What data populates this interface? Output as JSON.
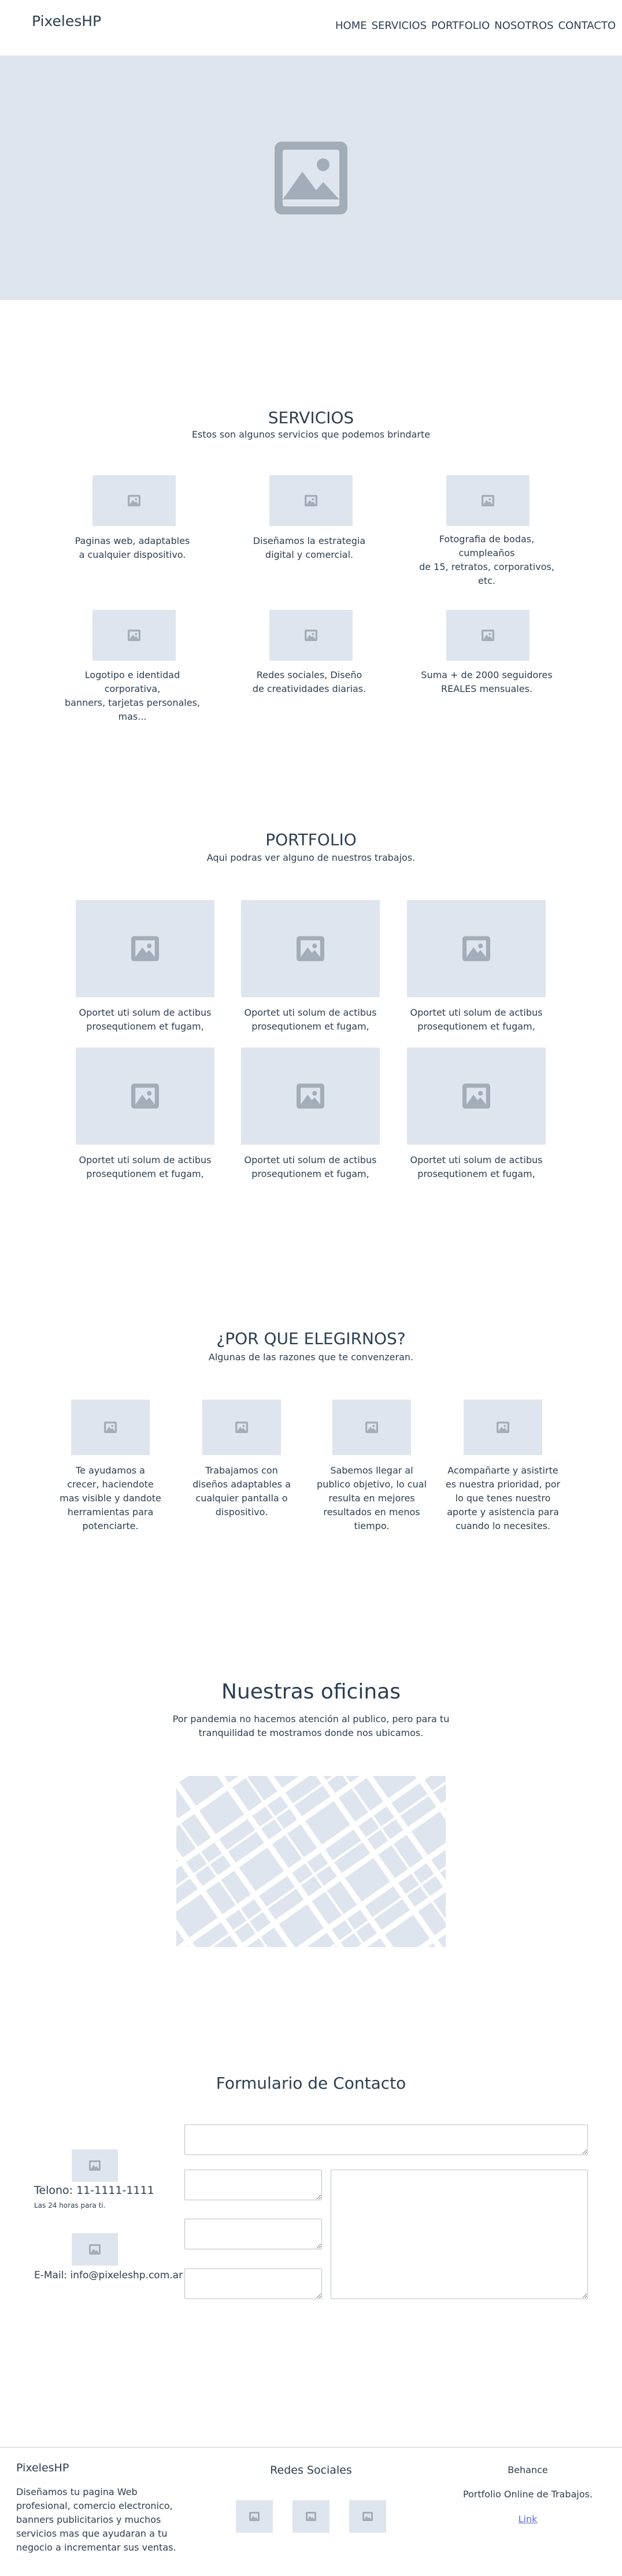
{
  "header": {
    "brand": "PixelesHP",
    "nav": [
      "HOME",
      "SERVICIOS",
      "PORTFOLIO",
      "NOSOTROS",
      "CONTACTO"
    ]
  },
  "hero": {
    "icon": "image-placeholder-icon"
  },
  "servicios": {
    "title": "SERVICIOS",
    "subtitle": "Estos son algunos servicios que podemos brindarte",
    "items": [
      {
        "lines": [
          "Paginas web, adaptables",
          "a cualquier dispositivo."
        ]
      },
      {
        "lines": [
          "Diseñamos la estrategia",
          "digital y comercial."
        ]
      },
      {
        "lines": [
          "Fotografia de bodas, cumpleaños",
          "de 15, retratos, corporativos, etc."
        ]
      },
      {
        "lines": [
          "Logotipo e identidad corporativa,",
          "banners, tarjetas personales,",
          "mas..."
        ]
      },
      {
        "lines": [
          "Redes sociales, Diseño",
          "de creatividades diarias."
        ]
      },
      {
        "lines": [
          "Suma + de 2000 seguidores",
          "REALES mensuales."
        ]
      }
    ]
  },
  "portfolio": {
    "title": "PORTFOLIO",
    "subtitle": "Aqui podras ver alguno de nuestros trabajos.",
    "items": [
      {
        "lines": [
          "Oportet uti solum de actibus",
          "prosequtionem et fugam,"
        ]
      },
      {
        "lines": [
          "Oportet uti solum de actibus",
          "prosequtionem et fugam,"
        ]
      },
      {
        "lines": [
          "Oportet uti solum de actibus",
          "prosequtionem et fugam,"
        ]
      },
      {
        "lines": [
          "Oportet uti solum de actibus",
          "prosequtionem et fugam,"
        ]
      },
      {
        "lines": [
          "Oportet uti solum de actibus",
          "prosequtionem et fugam,"
        ]
      },
      {
        "lines": [
          "Oportet uti solum de actibus",
          "prosequtionem et fugam,"
        ]
      }
    ]
  },
  "why": {
    "title": "¿POR QUE ELEGIRNOS?",
    "subtitle": "Algunas de las razones que te convenzeran.",
    "items": [
      {
        "lines": [
          "Te ayudamos a",
          "crecer, haciendote",
          "mas visible y dandote",
          "herramientas para",
          "potenciarte."
        ]
      },
      {
        "lines": [
          "Trabajamos con",
          "diseños adaptables a",
          "cualquier pantalla o",
          "dispositivo."
        ]
      },
      {
        "lines": [
          "Sabemos llegar al",
          "publico objetivo, lo cual",
          "resulta en mejores",
          "resultados en menos",
          "tiempo."
        ]
      },
      {
        "lines": [
          "Acompañarte y asistirte",
          "es nuestra prioridad, por",
          "lo que tenes nuestro",
          "aporte y asistencia para",
          "cuando lo necesites."
        ]
      }
    ]
  },
  "oficinas": {
    "title": "Nuestras oficinas",
    "lines": [
      "Por pandemia no hacemos atención al publico, pero para tu",
      "tranquilidad te mostramos donde nos ubicamos."
    ]
  },
  "contacto": {
    "title": "Formulario de Contacto",
    "phone": "Telono: 11-1111-1111",
    "hours": "Las 24 horas para ti.",
    "email": "E-Mail: info@pixeleshp.com.ar",
    "fields": {
      "name": "",
      "email": "",
      "phone": "",
      "subject": "",
      "message": ""
    }
  },
  "footer": {
    "brand": "PixelesHP",
    "about_lines": [
      "Diseñamos tu pagina Web",
      "profesional, comercio electronico,",
      "banners publicitarios y muchos",
      "servicios mas que ayudaran a tu",
      "negocio a incrementar sus ventas."
    ],
    "social_title": "Redes Sociales",
    "behance_title": "Behance",
    "behance_text": "Portfolio Online de Trabajos.",
    "link_label": "Link"
  },
  "colors": {
    "placeholder": "#dfe5ee",
    "placeholder_icon": "#a3adb9",
    "text": "#2c3e50",
    "link": "#5b6bd6"
  }
}
